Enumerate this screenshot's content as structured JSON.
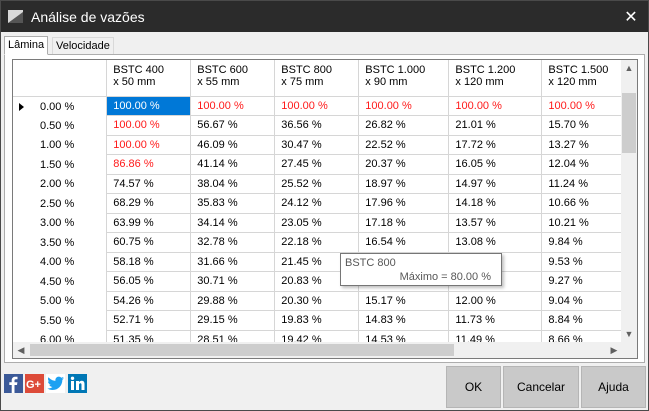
{
  "window": {
    "title": "Análise de vazões",
    "close_glyph": "✕"
  },
  "tabs": [
    {
      "label": "Lâmina",
      "active": true
    },
    {
      "label": "Velocidade",
      "active": false
    }
  ],
  "grid": {
    "columns": [
      {
        "line1": "BSTC 400",
        "line2": "x 50 mm"
      },
      {
        "line1": "BSTC 600",
        "line2": "x 55 mm"
      },
      {
        "line1": "BSTC 800",
        "line2": "x 75 mm"
      },
      {
        "line1": "BSTC 1.000",
        "line2": "x 90 mm"
      },
      {
        "line1": "BSTC 1.200",
        "line2": "x 120 mm"
      },
      {
        "line1": "BSTC 1.500",
        "line2": "x 120 mm"
      }
    ],
    "rows": [
      {
        "label": "0.00 %",
        "current": true,
        "cells": [
          "100.00 %",
          "100.00 %",
          "100.00 %",
          "100.00 %",
          "100.00 %",
          "100.00 %"
        ],
        "red": [
          1,
          1,
          1,
          1,
          1,
          1
        ]
      },
      {
        "label": "0.50 %",
        "cells": [
          "100.00 %",
          "56.67 %",
          "36.56 %",
          "26.82 %",
          "21.01 %",
          "15.70 %"
        ],
        "red": [
          1,
          0,
          0,
          0,
          0,
          0
        ]
      },
      {
        "label": "1.00 %",
        "cells": [
          "100.00 %",
          "46.09 %",
          "30.47 %",
          "22.52 %",
          "17.72 %",
          "13.27 %"
        ],
        "red": [
          1,
          0,
          0,
          0,
          0,
          0
        ]
      },
      {
        "label": "1.50 %",
        "cells": [
          "86.86 %",
          "41.14 %",
          "27.45 %",
          "20.37 %",
          "16.05 %",
          "12.04 %"
        ],
        "red": [
          1,
          0,
          0,
          0,
          0,
          0
        ]
      },
      {
        "label": "2.00 %",
        "cells": [
          "74.57 %",
          "38.04 %",
          "25.52 %",
          "18.97 %",
          "14.97 %",
          "11.24 %"
        ],
        "red": [
          0,
          0,
          0,
          0,
          0,
          0
        ]
      },
      {
        "label": "2.50 %",
        "cells": [
          "68.29 %",
          "35.83 %",
          "24.12 %",
          "17.96 %",
          "14.18 %",
          "10.66 %"
        ],
        "red": [
          0,
          0,
          0,
          0,
          0,
          0
        ]
      },
      {
        "label": "3.00 %",
        "cells": [
          "63.99 %",
          "34.14 %",
          "23.05 %",
          "17.18 %",
          "13.57 %",
          "10.21 %"
        ],
        "red": [
          0,
          0,
          0,
          0,
          0,
          0
        ]
      },
      {
        "label": "3.50 %",
        "cells": [
          "60.75 %",
          "32.78 %",
          "22.18 %",
          "16.54 %",
          "13.08 %",
          "9.84 %"
        ],
        "red": [
          0,
          0,
          0,
          0,
          0,
          0
        ]
      },
      {
        "label": "4.00 %",
        "cells": [
          "58.18 %",
          "31.66 %",
          "21.45 %",
          "",
          "",
          "9.53 %"
        ],
        "red": [
          0,
          0,
          0,
          0,
          0,
          0
        ]
      },
      {
        "label": "4.50 %",
        "cells": [
          "56.05 %",
          "30.71 %",
          "20.83 %",
          "",
          "",
          "9.27 %"
        ],
        "red": [
          0,
          0,
          0,
          0,
          0,
          0
        ]
      },
      {
        "label": "5.00 %",
        "cells": [
          "54.26 %",
          "29.88 %",
          "20.30 %",
          "15.17 %",
          "12.00 %",
          "9.04 %"
        ],
        "red": [
          0,
          0,
          0,
          0,
          0,
          0
        ]
      },
      {
        "label": "5.50 %",
        "cells": [
          "52.71 %",
          "29.15 %",
          "19.83 %",
          "14.83 %",
          "11.73 %",
          "8.84 %"
        ],
        "red": [
          0,
          0,
          0,
          0,
          0,
          0
        ]
      },
      {
        "label": "6.00 %",
        "cells": [
          "51.35 %",
          "28.51 %",
          "19.42 %",
          "14.53 %",
          "11.49 %",
          "8.66 %"
        ],
        "red": [
          0,
          0,
          0,
          0,
          0,
          0
        ]
      }
    ],
    "selected_cell": {
      "row": 0,
      "col": 0
    }
  },
  "tooltip": {
    "title": "BSTC 800",
    "text": "Máximo = 80.00 %"
  },
  "social": [
    "facebook-icon",
    "google-plus-icon",
    "twitter-icon",
    "linkedin-icon"
  ],
  "buttons": {
    "ok": "OK",
    "cancel": "Cancelar",
    "help": "Ajuda"
  },
  "colors": {
    "titlebar": "#2b2b2b",
    "over_limit": "#ff1a1a",
    "selection": "#0078d7"
  }
}
